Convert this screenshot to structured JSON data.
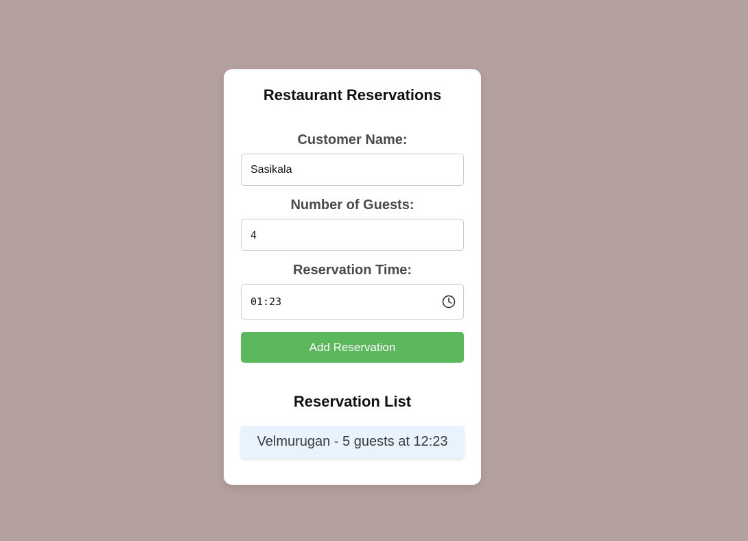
{
  "app": {
    "title": "Restaurant Reservations"
  },
  "form": {
    "name_label": "Customer Name:",
    "name_value": "Sasikala",
    "guests_label": "Number of Guests:",
    "guests_value": "4",
    "time_label": "Reservation Time:",
    "time_value": "01:23",
    "time_icon": "clock-icon",
    "submit_label": "Add Reservation"
  },
  "list": {
    "title": "Reservation List",
    "items": [
      "Velmurugan - 5 guests at 12:23"
    ]
  },
  "colors": {
    "background": "#b3a09f",
    "card": "#ffffff",
    "button": "#5cb85c",
    "list_item": "#e8f3fd"
  }
}
